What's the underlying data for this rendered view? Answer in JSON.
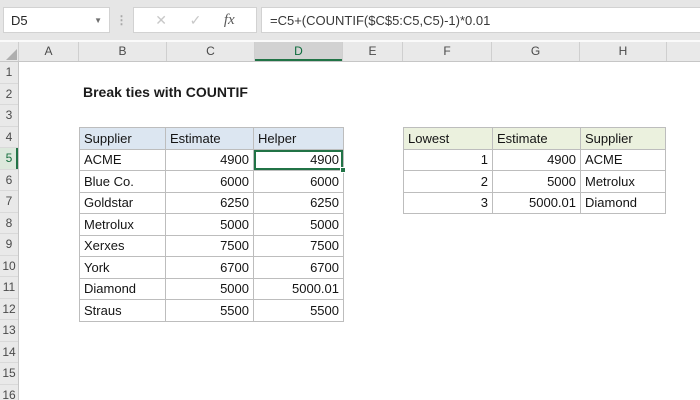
{
  "formula_bar": {
    "name_box_value": "D5",
    "dropdown_icon": "▼",
    "drag_icon": "⋮",
    "cancel_label": "✕",
    "enter_label": "✓",
    "fx_label": "fx",
    "formula": "=C5+(COUNTIF($C$5:C5,C5)-1)*0.01"
  },
  "sheet": {
    "column_headers": [
      "A",
      "B",
      "C",
      "D",
      "E",
      "F",
      "G",
      "H"
    ],
    "selected_column": "D",
    "row_headers": [
      "1",
      "2",
      "3",
      "4",
      "5",
      "6",
      "7",
      "8",
      "9",
      "10",
      "11",
      "12",
      "13",
      "14",
      "15",
      "16"
    ],
    "selected_row": "5",
    "selected_cell": "D5",
    "title_cell": "Break ties with COUNTIF"
  },
  "table1": {
    "headers": [
      "Supplier",
      "Estimate",
      "Helper"
    ],
    "rows": [
      [
        "ACME",
        "4900",
        "4900"
      ],
      [
        "Blue Co.",
        "6000",
        "6000"
      ],
      [
        "Goldstar",
        "6250",
        "6250"
      ],
      [
        "Metrolux",
        "5000",
        "5000"
      ],
      [
        "Xerxes",
        "7500",
        "7500"
      ],
      [
        "York",
        "6700",
        "6700"
      ],
      [
        "Diamond",
        "5000",
        "5000.01"
      ],
      [
        "Straus",
        "5500",
        "5500"
      ]
    ]
  },
  "table2": {
    "headers": [
      "Lowest",
      "Estimate",
      "Supplier"
    ],
    "rows": [
      [
        "1",
        "4900",
        "ACME"
      ],
      [
        "2",
        "5000",
        "Metrolux"
      ],
      [
        "3",
        "5000.01",
        "Diamond"
      ]
    ]
  },
  "colors": {
    "accent_green": "#217346",
    "table1_header_bg": "#DCE6F1",
    "table2_header_bg": "#EBF1DE",
    "selected_column_header_bg": "#D2D2D2",
    "selected_row_header_bg": "#DCE8DC",
    "toolbar_bg": "#E6E6E6",
    "table_border": "#BDBDBD"
  }
}
